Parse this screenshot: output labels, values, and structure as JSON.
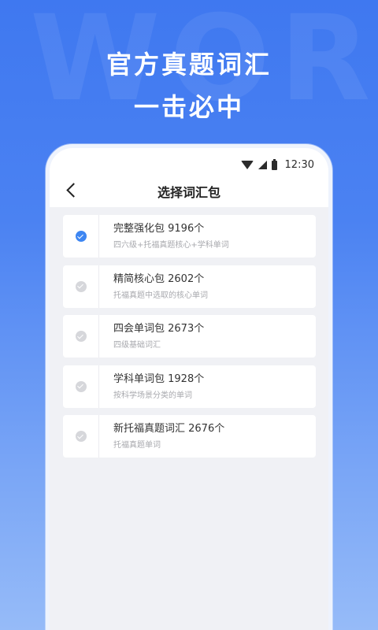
{
  "promo": {
    "bg_word": "WOR",
    "title_line1": "官方真题词汇",
    "title_line2": "一击必中"
  },
  "status_bar": {
    "time": "12:30"
  },
  "nav": {
    "title": "选择词汇包"
  },
  "packages": [
    {
      "name": "完整强化包 9196个",
      "desc": "四六级+托福真题核心+学科单词",
      "selected": true
    },
    {
      "name": "精简核心包 2602个",
      "desc": "托福真题中选取的核心单词",
      "selected": false
    },
    {
      "name": "四会单词包 2673个",
      "desc": "四级基础词汇",
      "selected": false
    },
    {
      "name": "学科单词包 1928个",
      "desc": "按科学场景分类的单词",
      "selected": false
    },
    {
      "name": "新托福真题词汇 2676个",
      "desc": "托福真题单词",
      "selected": false
    }
  ],
  "colors": {
    "accent": "#3d86f2",
    "background_top": "#3f78f0",
    "background_bottom": "#96bbf8"
  }
}
